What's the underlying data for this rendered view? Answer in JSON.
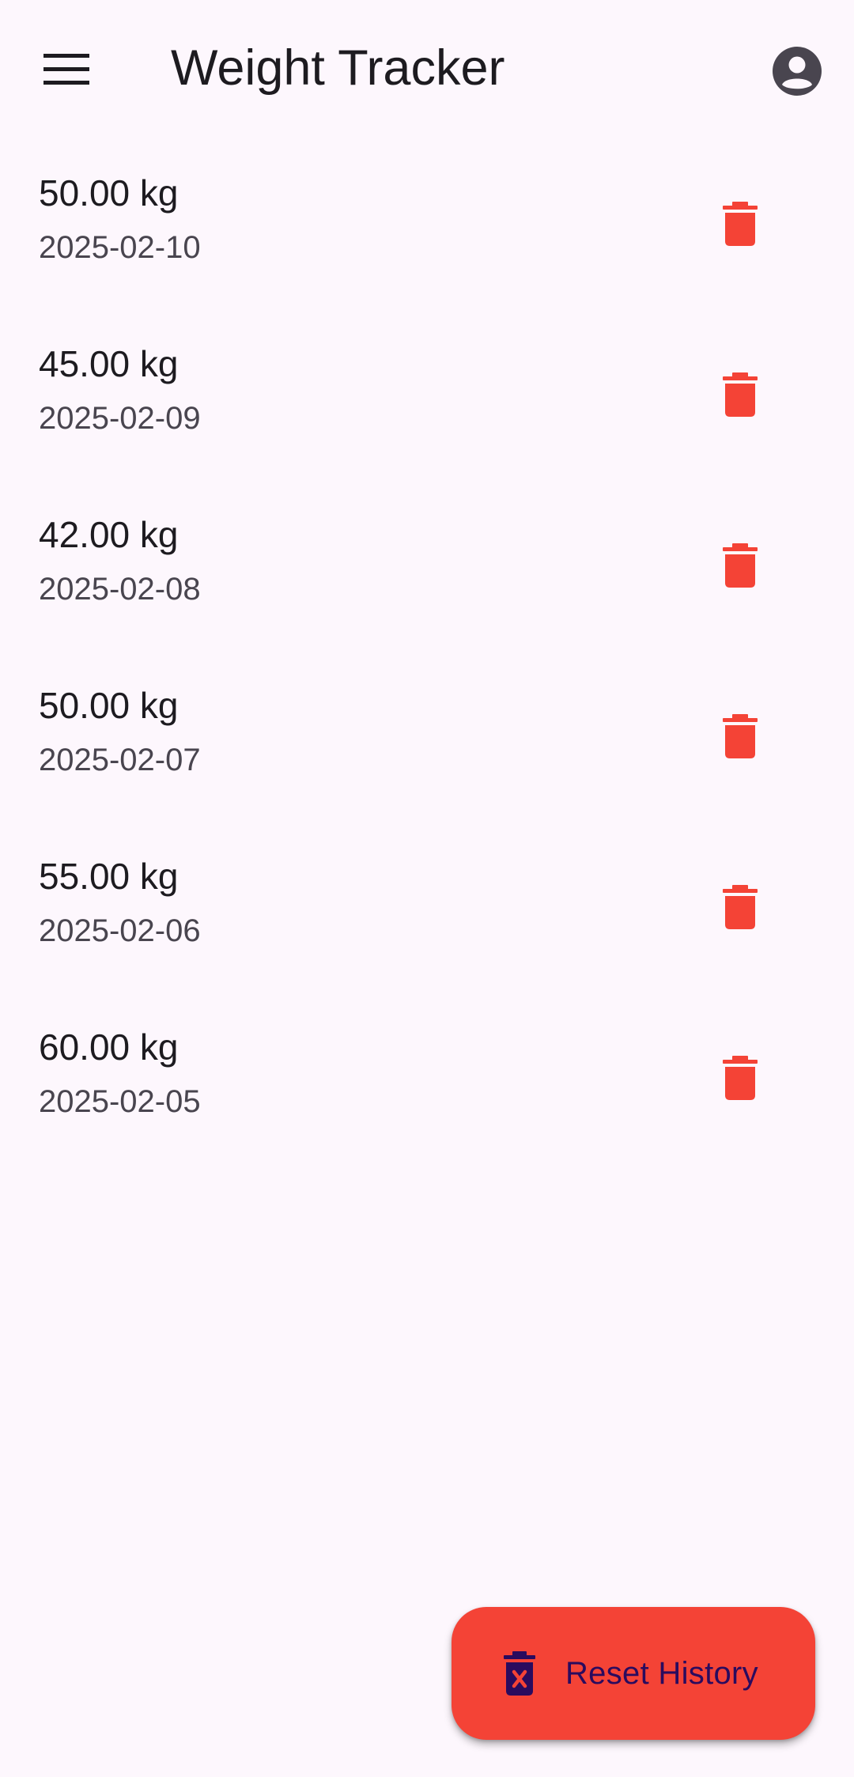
{
  "app_bar": {
    "title": "Weight Tracker",
    "menu_icon": "menu-icon",
    "account_icon": "account-circle-icon"
  },
  "entries": [
    {
      "weight": "50.00 kg",
      "date": "2025-02-10"
    },
    {
      "weight": "45.00 kg",
      "date": "2025-02-09"
    },
    {
      "weight": "42.00 kg",
      "date": "2025-02-08"
    },
    {
      "weight": "50.00 kg",
      "date": "2025-02-07"
    },
    {
      "weight": "55.00 kg",
      "date": "2025-02-06"
    },
    {
      "weight": "60.00 kg",
      "date": "2025-02-05"
    }
  ],
  "delete_icon": "trash-icon",
  "fab": {
    "label": "Reset History",
    "icon": "delete-forever-icon"
  },
  "colors": {
    "background": "#fdf7fd",
    "delete_red": "#f44336",
    "fab_background": "#f44336",
    "fab_label": "#2a0b5e",
    "title_text": "#1d1b20",
    "secondary_text": "#49454f"
  }
}
